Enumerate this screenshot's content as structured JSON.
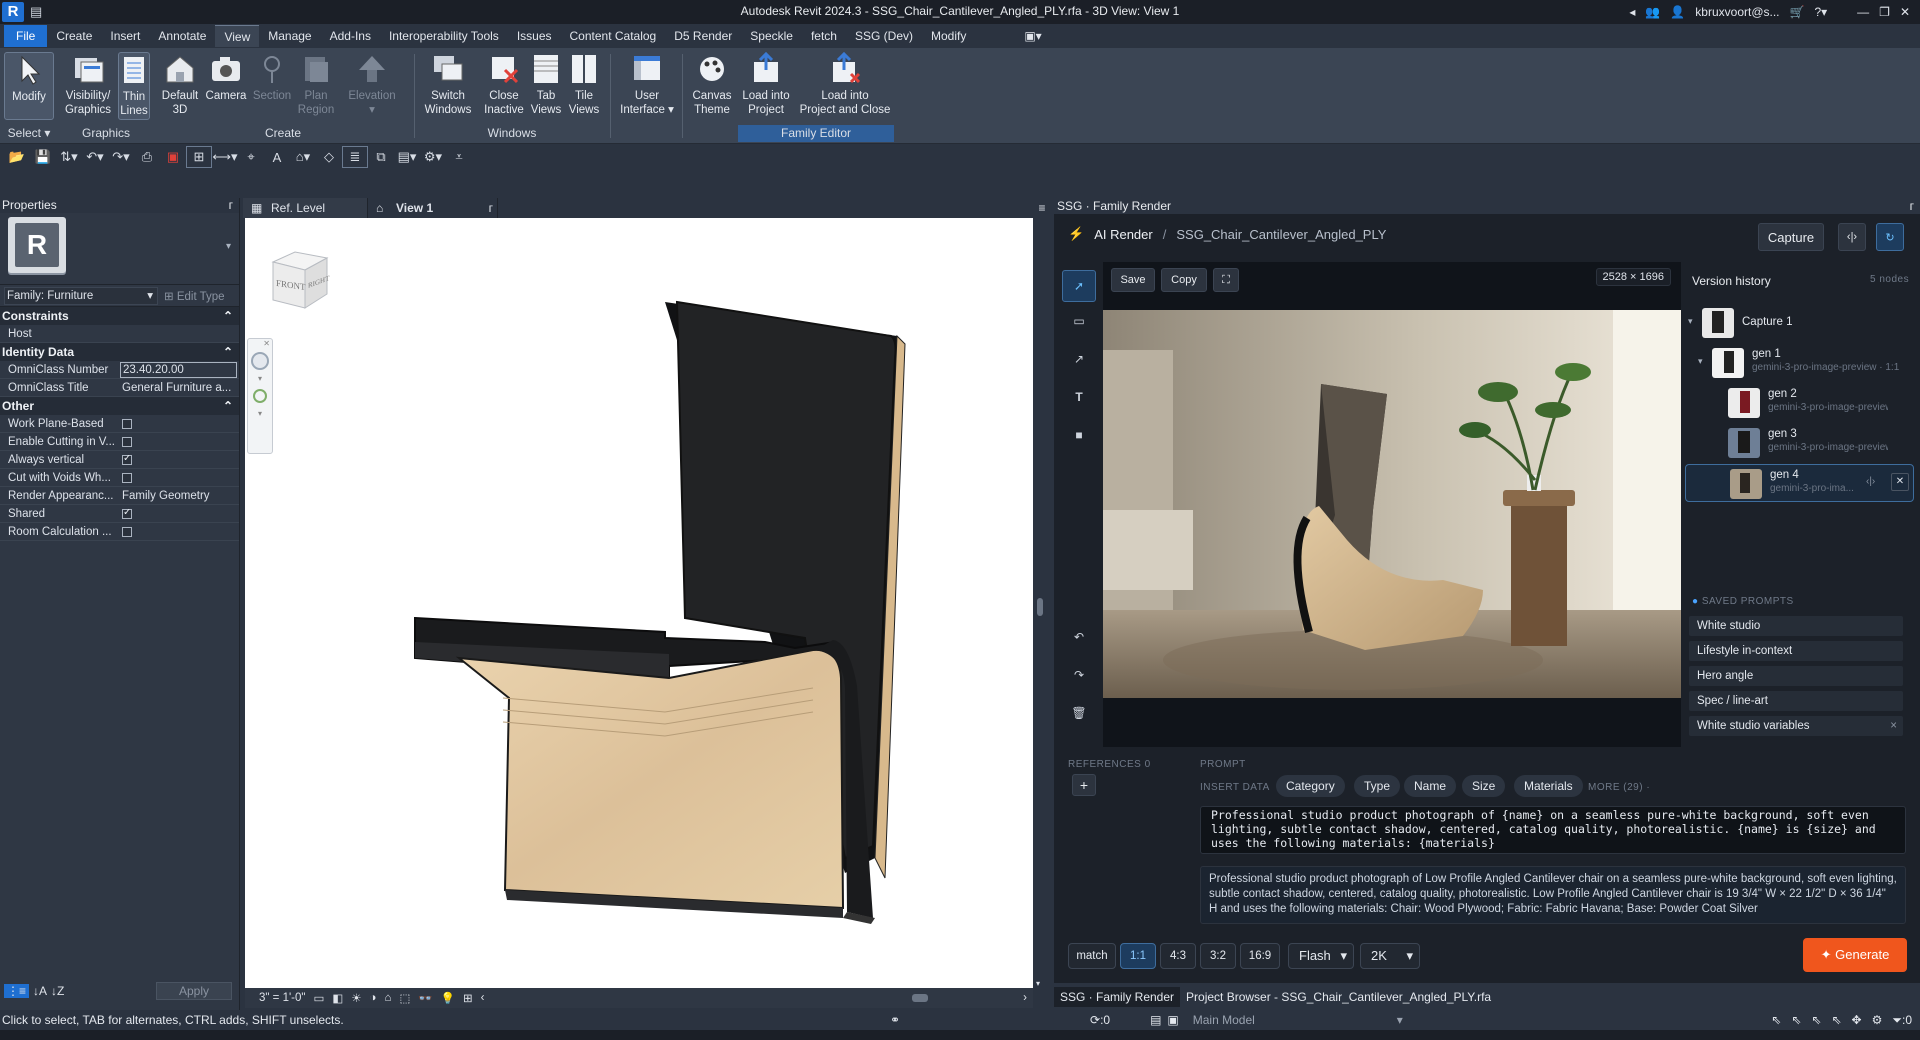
{
  "window": {
    "title": "Autodesk Revit 2024.3 - SSG_Chair_Cantilever_Angled_PLY.rfa - 3D View: View 1",
    "user": "kbruxvoort@s...",
    "app_icon": "R"
  },
  "ribbon_tabs": [
    "File",
    "Create",
    "Insert",
    "Annotate",
    "View",
    "Manage",
    "Add-Ins",
    "Interoperability Tools",
    "Issues",
    "Content Catalog",
    "D5 Render",
    "Speckle",
    "fetch",
    "SSG (Dev)",
    "Modify"
  ],
  "ribbon": {
    "buttons": [
      {
        "l1": "Modify",
        "l2": ""
      },
      {
        "l1": "Visibility/",
        "l2": "Graphics"
      },
      {
        "l1": "Thin",
        "l2": "Lines"
      },
      {
        "l1": "Default",
        "l2": "3D"
      },
      {
        "l1": "Camera",
        "l2": ""
      },
      {
        "l1": "Section",
        "l2": ""
      },
      {
        "l1": "Plan",
        "l2": "Region"
      },
      {
        "l1": "Elevation",
        "l2": ""
      },
      {
        "l1": "Switch",
        "l2": "Windows"
      },
      {
        "l1": "Close",
        "l2": "Inactive"
      },
      {
        "l1": "Tab",
        "l2": "Views"
      },
      {
        "l1": "Tile",
        "l2": "Views"
      },
      {
        "l1": "User",
        "l2": "Interface"
      },
      {
        "l1": "Canvas",
        "l2": "Theme"
      },
      {
        "l1": "Load into",
        "l2": "Project"
      },
      {
        "l1": "Load into",
        "l2": "Project and Close"
      }
    ],
    "groups": {
      "select": "Select",
      "graphics": "Graphics",
      "create": "Create",
      "windows": "Windows",
      "family_editor": "Family Editor"
    }
  },
  "properties": {
    "title": "Properties",
    "family": "Family: Furniture",
    "edit_type": "Edit Type",
    "sections": {
      "constraints": "Constraints",
      "identity": "Identity Data",
      "other": "Other"
    },
    "rows": {
      "host": {
        "k": "Host",
        "v": ""
      },
      "omni_num": {
        "k": "OmniClass Number",
        "v": "23.40.20.00"
      },
      "omni_title": {
        "k": "OmniClass Title",
        "v": "General Furniture a..."
      },
      "work_plane": {
        "k": "Work Plane-Based",
        "v": false
      },
      "enable_cut": {
        "k": "Enable Cutting in V...",
        "v": false
      },
      "always_vert": {
        "k": "Always vertical",
        "v": true
      },
      "cut_voids": {
        "k": "Cut with Voids Wh...",
        "v": false
      },
      "render_app": {
        "k": "Render Appearanc...",
        "v": "Family Geometry"
      },
      "shared": {
        "k": "Shared",
        "v": true
      },
      "room_calc": {
        "k": "Room Calculation ...",
        "v": false
      }
    },
    "apply": "Apply"
  },
  "view": {
    "tabs": [
      "Ref. Level",
      "View 1"
    ],
    "scale": "3\" = 1'-0\"",
    "viewcube": {
      "front": "FRONT",
      "right": "RIGHT"
    }
  },
  "ssg": {
    "panel_title": "SSG · Family Render",
    "breadcrumb_root": "AI Render",
    "breadcrumb_file": "SSG_Chair_Cantilever_Angled_PLY",
    "capture": "Capture",
    "save": "Save",
    "copy": "Copy",
    "image_size": "2528 × 1696",
    "version_history": "Version history",
    "nodes": "5 nodes",
    "versions": [
      {
        "name": "Capture 1",
        "sub": ""
      },
      {
        "name": "gen 1",
        "sub": "gemini-3-pro-image-preview · 1:1"
      },
      {
        "name": "gen 2",
        "sub": "gemini-3-pro-image-preview · ..."
      },
      {
        "name": "gen 3",
        "sub": "gemini-3-pro-image-preview · ..."
      },
      {
        "name": "gen 4",
        "sub": "gemini-3-pro-ima..."
      }
    ],
    "saved_prompts_label": "SAVED PROMPTS",
    "saved_prompts": [
      "White studio",
      "Lifestyle in-context",
      "Hero angle",
      "Spec / line-art",
      "White studio variables"
    ],
    "references_label": "REFERENCES 0",
    "prompt_label": "PROMPT",
    "insert_data_label": "INSERT DATA",
    "insert_pills": [
      "Category",
      "Type",
      "Name",
      "Size",
      "Materials"
    ],
    "more": "MORE (29) ·",
    "prompt_template": "Professional studio product photograph of {name} on a seamless pure-white background, soft even lighting, subtle contact shadow, centered, catalog quality, photorealistic. {name} is {size} and uses the following materials: {materials}",
    "prompt_resolved": "Professional studio product photograph of Low Profile Angled Cantilever chair on a seamless pure-white background, soft even lighting, subtle contact shadow, centered, catalog quality, photorealistic. Low Profile Angled Cantilever chair is 19 3/4\" W × 22 1/2\" D × 36 1/4\" H and uses the following materials: Chair: Wood Plywood; Fabric: Fabric Havana; Base: Powder Coat Silver",
    "aspect": [
      "match",
      "1:1",
      "4:3",
      "3:2",
      "16:9"
    ],
    "model": "Flash",
    "resolution": "2K",
    "generate": "✦ Generate"
  },
  "panel_tabs": [
    "SSG · Family Render",
    "Project Browser - SSG_Chair_Cantilever_Angled_PLY.rfa"
  ],
  "status": {
    "hint": "Click to select, TAB for alternates, CTRL adds, SHIFT unselects.",
    "model": "Main Model",
    "zero1": ":0",
    "zero2": ":0"
  }
}
